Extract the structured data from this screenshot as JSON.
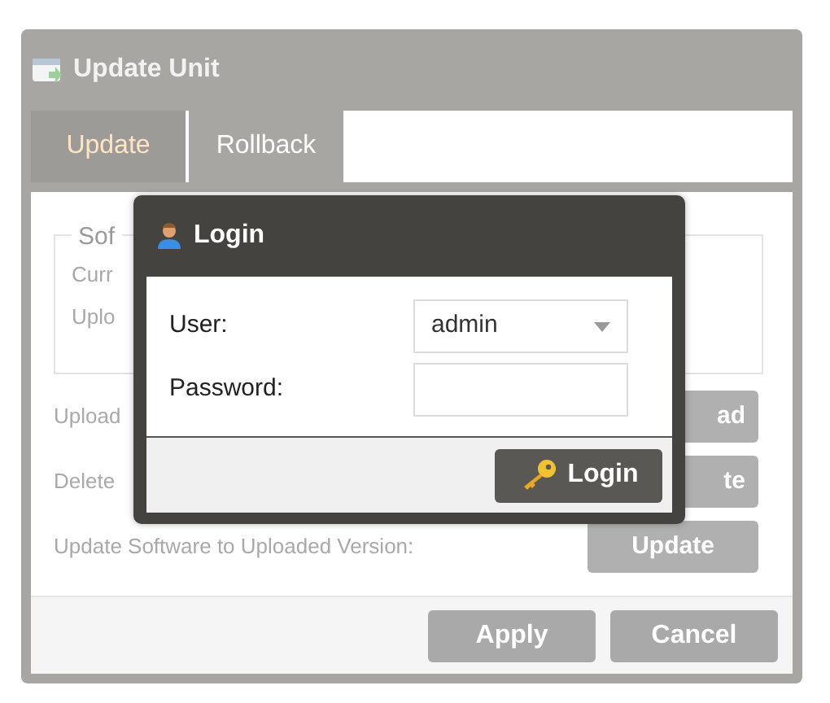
{
  "window": {
    "title": "Update Unit"
  },
  "tabs": [
    {
      "label": "Update",
      "selected": true
    },
    {
      "label": "Rollback",
      "selected": false
    }
  ],
  "software_group": {
    "legend": "Sof",
    "lines": [
      "Curr",
      "Uplo"
    ]
  },
  "actions": [
    {
      "label": "Upload",
      "button": "ad"
    },
    {
      "label": "Delete",
      "button": "te"
    },
    {
      "label": "Update Software to Uploaded Version:",
      "button": "Update"
    }
  ],
  "footer_buttons": [
    "Apply",
    "Cancel"
  ],
  "login_dialog": {
    "title": "Login",
    "user_label": "User:",
    "user_value": "admin",
    "password_label": "Password:",
    "button": "Login"
  }
}
